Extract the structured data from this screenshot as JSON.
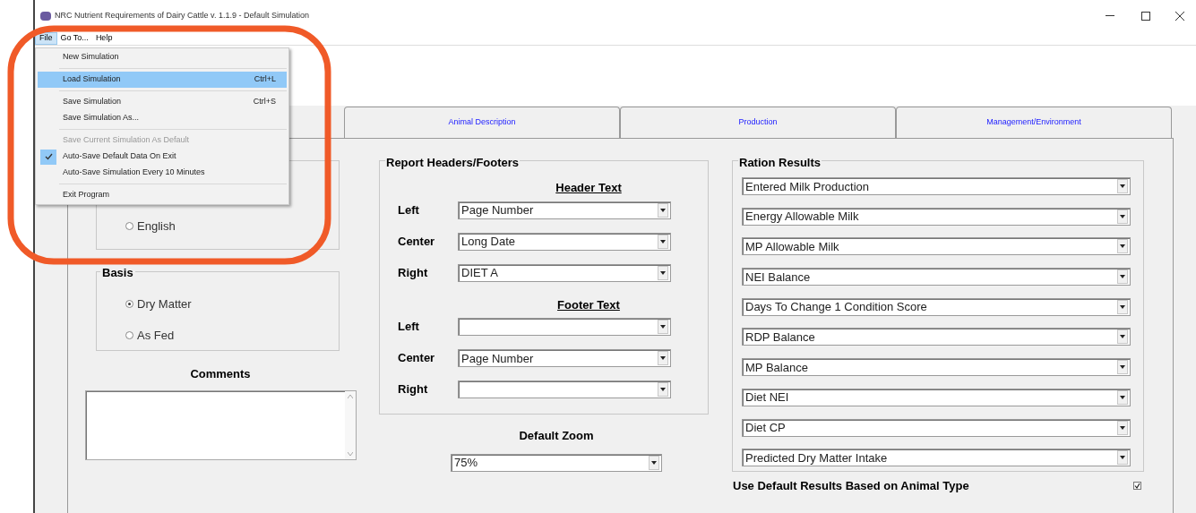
{
  "window": {
    "title": "NRC Nutrient Requirements of Dairy Cattle v. 1.1.9 - Default Simulation"
  },
  "menu_bar": [
    {
      "label": "File",
      "selected": true
    },
    {
      "label": "Go To...",
      "selected": false
    },
    {
      "label": "Help",
      "selected": false
    }
  ],
  "file_menu": [
    {
      "kind": "item",
      "label": "New Simulation",
      "selected": false,
      "disabled": false,
      "checked": false
    },
    {
      "kind": "separator"
    },
    {
      "kind": "item",
      "label": "Load Simulation",
      "shortcut": "Ctrl+L",
      "selected": true,
      "disabled": false,
      "checked": false
    },
    {
      "kind": "separator"
    },
    {
      "kind": "item",
      "label": "Save Simulation",
      "shortcut": "Ctrl+S",
      "selected": false,
      "disabled": false,
      "checked": false
    },
    {
      "kind": "item",
      "label": "Save Simulation As...",
      "selected": false,
      "disabled": false,
      "checked": false
    },
    {
      "kind": "separator"
    },
    {
      "kind": "item",
      "label": "Save Current Simulation As Default",
      "selected": false,
      "disabled": true,
      "checked": false
    },
    {
      "kind": "item",
      "label": "Auto-Save Default Data On Exit",
      "selected": false,
      "disabled": false,
      "checked": true
    },
    {
      "kind": "item",
      "label": "Auto-Save Simulation Every 10 Minutes",
      "selected": false,
      "disabled": false,
      "checked": false
    },
    {
      "kind": "separator"
    },
    {
      "kind": "item",
      "label": "Exit Program",
      "selected": false,
      "disabled": false,
      "checked": false
    }
  ],
  "tabs": [
    {
      "label": "Animal Description",
      "selected": false
    },
    {
      "label": "Production",
      "selected": false
    },
    {
      "label": "Management/Environment",
      "selected": false
    }
  ],
  "units": {
    "options": [
      {
        "label": "English",
        "selected": false
      }
    ]
  },
  "basis": {
    "title": "Basis",
    "options": [
      {
        "label": "Dry Matter",
        "selected": true
      },
      {
        "label": "As Fed",
        "selected": false
      }
    ]
  },
  "comments": {
    "label": "Comments"
  },
  "report": {
    "title": "Report Headers/Footers",
    "header": {
      "title": "Header Text",
      "rows": [
        {
          "label": "Left",
          "value": "Page Number"
        },
        {
          "label": "Center",
          "value": "Long Date"
        },
        {
          "label": "Right",
          "value": "DIET A"
        }
      ]
    },
    "footer": {
      "title": "Footer Text",
      "rows": [
        {
          "label": "Left"
        },
        {
          "label": "Center",
          "value": "Page Number"
        },
        {
          "label": "Right"
        }
      ]
    }
  },
  "default_zoom": {
    "label": "Default Zoom",
    "value": "75%"
  },
  "ration_results": {
    "title": "Ration Results",
    "items": [
      "Entered Milk Production",
      "Energy Allowable Milk",
      "MP Allowable Milk",
      "NEI Balance",
      "Days To Change 1 Condition Score",
      "RDP Balance",
      "MP Balance",
      "Diet NEI",
      "Diet CP",
      "Predicted Dry Matter Intake"
    ]
  },
  "use_default": {
    "label": "Use Default Results Based on Animal Type",
    "checked": true
  }
}
